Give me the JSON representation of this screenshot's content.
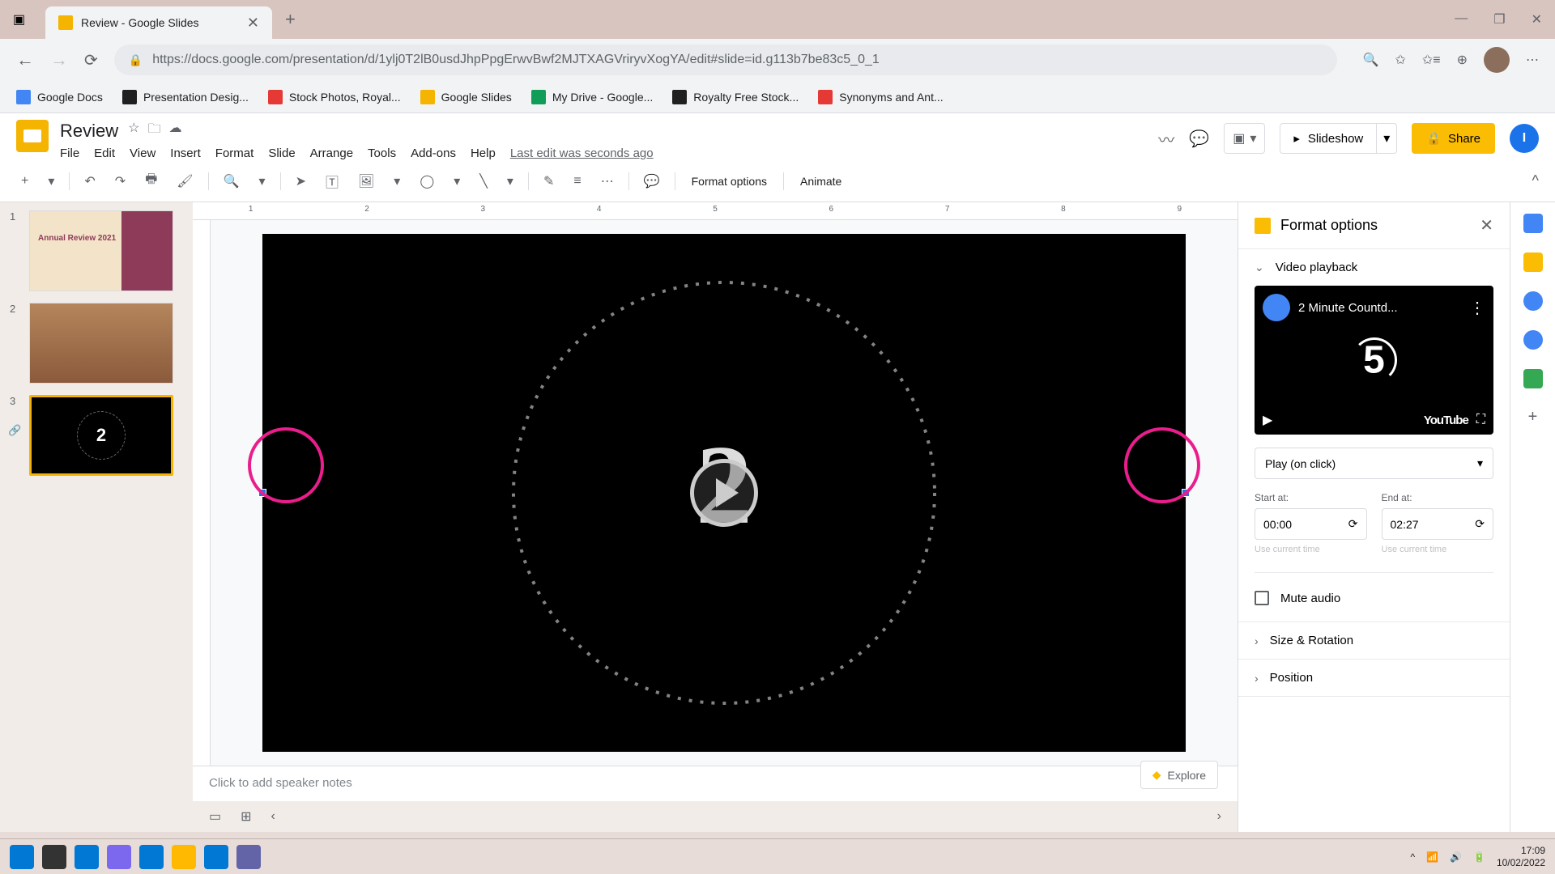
{
  "browser": {
    "tab_title": "Review - Google Slides",
    "url": "https://docs.google.com/presentation/d/1ylj0T2lB0usdJhpPpgErwvBwf2MJTXAGVriryvXogYA/edit#slide=id.g113b7be83c5_0_1",
    "minimize": "—",
    "maximize": "❐",
    "close": "✕",
    "new_tab": "+",
    "tab_close": "✕"
  },
  "bookmarks": [
    {
      "label": "Google Docs",
      "color": "#4285f4"
    },
    {
      "label": "Presentation Desig...",
      "color": "#202020"
    },
    {
      "label": "Stock Photos, Royal...",
      "color": "#e53935"
    },
    {
      "label": "Google Slides",
      "color": "#f4b400"
    },
    {
      "label": "My Drive - Google...",
      "color": "#0f9d58"
    },
    {
      "label": "Royalty Free Stock...",
      "color": "#202020"
    },
    {
      "label": "Synonyms and Ant...",
      "color": "#e53935"
    }
  ],
  "app": {
    "doc_title": "Review",
    "menus": [
      "File",
      "Edit",
      "View",
      "Insert",
      "Format",
      "Slide",
      "Arrange",
      "Tools",
      "Add-ons",
      "Help"
    ],
    "last_edit": "Last edit was seconds ago",
    "slideshow_label": "Slideshow",
    "share_label": "Share",
    "user_initial": "I"
  },
  "toolbar": {
    "format_options": "Format options",
    "animate": "Animate"
  },
  "ruler_marks": [
    "1",
    "2",
    "3",
    "4",
    "5",
    "6",
    "7",
    "8",
    "9"
  ],
  "slides": [
    {
      "num": "1",
      "title": "Annual Review 2021"
    },
    {
      "num": "2",
      "title": ""
    },
    {
      "num": "3",
      "title": ""
    }
  ],
  "canvas": {
    "big_number": "2"
  },
  "speaker_notes_placeholder": "Click to add speaker notes",
  "explore_label": "Explore",
  "format_pane": {
    "title": "Format options",
    "sections": {
      "video_playback": "Video playback",
      "size_rotation": "Size & Rotation",
      "position": "Position"
    },
    "video_title": "2 Minute Countd...",
    "preview_number": "5",
    "youtube_label": "YouTube",
    "play_mode": "Play (on click)",
    "start_label": "Start at:",
    "end_label": "End at:",
    "start_value": "00:00",
    "end_value": "02:27",
    "use_current": "Use current time",
    "mute_label": "Mute audio"
  },
  "taskbar": {
    "time": "17:09",
    "date": "10/02/2022"
  }
}
